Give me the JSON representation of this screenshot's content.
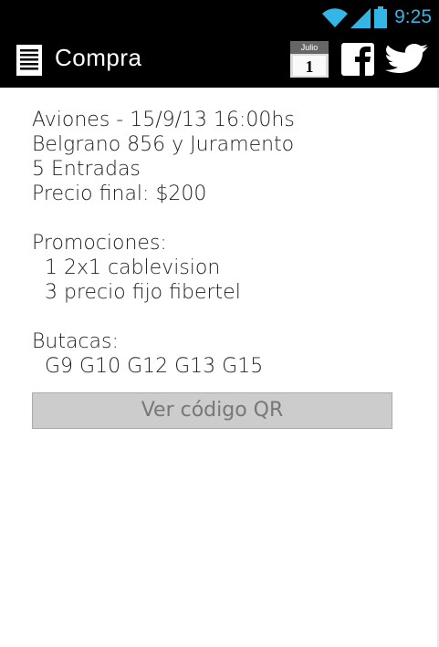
{
  "status_bar": {
    "time": "9:25"
  },
  "action_bar": {
    "title": "Compra",
    "calendar": {
      "month": "Julio",
      "day": "1"
    }
  },
  "purchase": {
    "event_line": "Aviones - 15/9/13 16:00hs",
    "address": "Belgrano 856 y Juramento",
    "tickets": "5 Entradas",
    "price": "Precio final: $200",
    "promotions_label": "Promociones:",
    "promotions": [
      "1 2x1 cablevision",
      "3 precio fijo fibertel"
    ],
    "seats_label": "Butacas:",
    "seats": "G9 G10 G12 G13 G15"
  },
  "qr_button_label": "Ver código QR"
}
